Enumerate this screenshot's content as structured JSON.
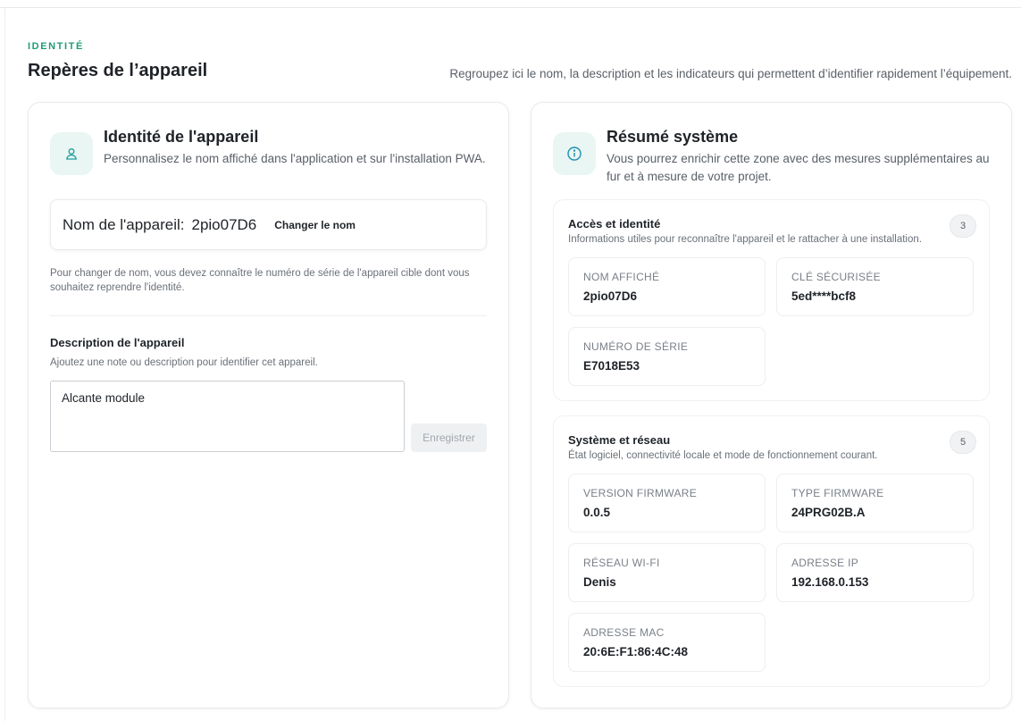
{
  "header": {
    "eyebrow": "IDENTITÉ",
    "title": "Repères de l’appareil",
    "subtitle": "Regroupez ici le nom, la description et les indicateurs qui permettent d’identifier rapidement l’équipement."
  },
  "identity_card": {
    "icon": "user-icon",
    "title": "Identité de l'appareil",
    "description": "Personnalisez le nom affiché dans l'application et sur l'installation PWA.",
    "name_label": "Nom de l'appareil:",
    "name_value": "2pio07D6",
    "rename_label": "Changer le nom",
    "help_text": "Pour changer de nom, vous devez connaître le numéro de série de l'appareil cible dont vous souhaitez reprendre l'identité.",
    "desc_title": "Description de l'appareil",
    "desc_subtitle": "Ajoutez une note ou description pour identifier cet appareil.",
    "desc_value": "Alcante module",
    "save_label": "Enregistrer"
  },
  "summary_card": {
    "icon": "info-icon",
    "title": "Résumé système",
    "description": "Vous pourrez enrichir cette zone avec des mesures supplémentaires au fur et à mesure de votre projet.",
    "access": {
      "title": "Accès et identité",
      "subtitle": "Informations utiles pour reconnaître l'appareil et le rattacher à une installation.",
      "count": "3",
      "items": [
        {
          "label": "Nom affiché",
          "value": "2pio07D6"
        },
        {
          "label": "Clé sécurisée",
          "value": "5ed****bcf8"
        },
        {
          "label": "Numéro de série",
          "value": "E7018E53"
        }
      ]
    },
    "system": {
      "title": "Système et réseau",
      "subtitle": "État logiciel, connectivité locale et mode de fonctionnement courant.",
      "count": "5",
      "items": [
        {
          "label": "Version firmware",
          "value": "0.0.5"
        },
        {
          "label": "Type firmware",
          "value": "24PRG02B.A"
        },
        {
          "label": "Réseau Wi-Fi",
          "value": "Denis"
        },
        {
          "label": "Adresse IP",
          "value": "192.168.0.153"
        },
        {
          "label": "Adresse MAC",
          "value": "20:6E:F1:86:4C:48"
        }
      ]
    }
  }
}
